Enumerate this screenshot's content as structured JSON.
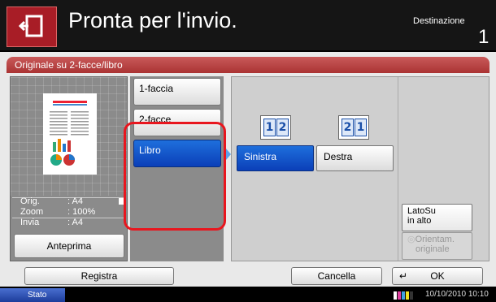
{
  "header": {
    "title": "Pronta per l'invio.",
    "destination_label": "Destinazione",
    "destination_count": "1"
  },
  "section": {
    "tab_label": "Originale su 2-facce/libro"
  },
  "preview": {
    "info": [
      {
        "key": "Orig.",
        "value": ": A4"
      },
      {
        "key": "Zoom",
        "value": ": 100%"
      },
      {
        "key": "Invia",
        "value": ": A4"
      }
    ],
    "button_label": "Anteprima"
  },
  "options": {
    "items": [
      {
        "label": "1-faccia",
        "selected": false
      },
      {
        "label": "2-facce",
        "selected": false
      },
      {
        "label": "Libro",
        "selected": true
      }
    ]
  },
  "binding": {
    "left_label": "Sinistra",
    "right_label": "Destra",
    "left_selected": true,
    "icon_left_pages": [
      "1",
      "2"
    ],
    "icon_right_pages": [
      "2",
      "1"
    ]
  },
  "orientation": {
    "top_label_line1": "LatoSu",
    "top_label_line2": "in alto",
    "orient_label_line1": "Orientam.",
    "orient_label_line2": "originale"
  },
  "footer": {
    "register_label": "Registra",
    "cancel_label": "Cancella",
    "ok_label": "OK"
  },
  "status_bar": {
    "status_label": "Stato",
    "datetime": "10/10/2010  10:10"
  },
  "colors": {
    "accent_red": "#a81d26",
    "selection_blue": "#0b3fb8",
    "highlight_ring": "#e8161e"
  }
}
